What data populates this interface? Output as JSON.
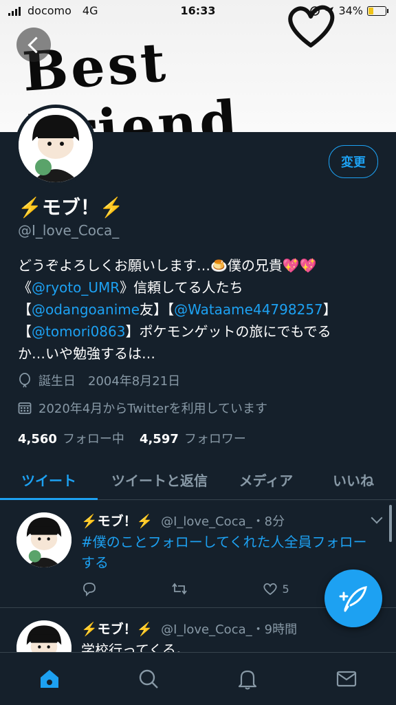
{
  "status_bar": {
    "carrier": "docomo",
    "network": "4G",
    "time": "16:33",
    "battery": "34%",
    "battery_level": 0.34
  },
  "banner": {
    "text": "Best Friend",
    "icon": "heart-doodle"
  },
  "profile": {
    "edit_label": "変更",
    "display_name": "⚡️モブ！⚡️",
    "handle": "@I_love_Coca_",
    "bio": {
      "line1_text": "どうぞよろしくお願いします…🍮僕の兄貴💖💖",
      "line2_pre": "《",
      "line2_link": "@ryoto_UMR",
      "line2_post": "》信頼してる人たち",
      "line3_pre": "【",
      "line3_link1": "@odangoanime",
      "line3_mid": "友】【",
      "line3_link2": "@Wataame44798257",
      "line3_post": "】",
      "line4_pre": "【",
      "line4_link": "@tomori0863",
      "line4_post": "】ポケモンゲットの旅にでもでる",
      "line5": "か…いや勉強するは…"
    },
    "birthday_label": "誕生日",
    "birthday": "2004年8月21日",
    "joined": "2020年4月からTwitterを利用しています",
    "following_count": "4,560",
    "following_label": "フォロー中",
    "followers_count": "4,597",
    "followers_label": "フォロワー"
  },
  "tabs": [
    "ツイート",
    "ツイートと返信",
    "メディア",
    "いいね"
  ],
  "tweets": [
    {
      "name": "⚡️モブ！⚡️",
      "handle": "@I_love_Coca_",
      "time": "・8分",
      "text": "#僕のことフォローしてくれた人全員フォローする",
      "likes": "5"
    },
    {
      "name": "⚡️モブ！⚡️",
      "handle": "@I_love_Coca_",
      "time": "・9時間",
      "text": "学校行ってくる。"
    }
  ],
  "nav": [
    "home-icon",
    "search-icon",
    "bell-icon",
    "mail-icon"
  ],
  "colors": {
    "accent": "#1da1f2",
    "background": "#15202b",
    "muted": "#8899a6",
    "border": "#38444d"
  }
}
